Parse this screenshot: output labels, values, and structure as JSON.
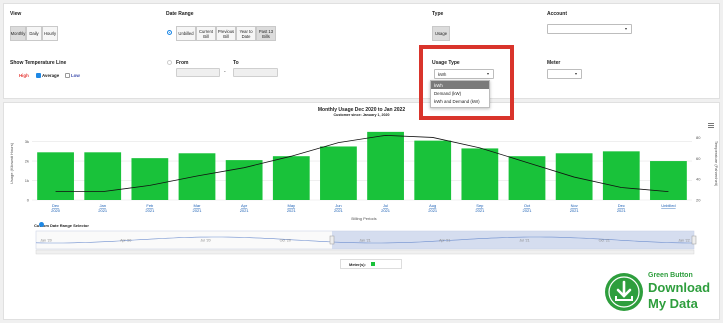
{
  "view": {
    "label": "View",
    "options": [
      "Monthly",
      "Daily",
      "Hourly"
    ],
    "selected": "Monthly"
  },
  "date_range": {
    "label": "Date Range",
    "options": [
      "Unbilled",
      "Current Bill",
      "Previous Bill",
      "Year to Date",
      "Past 13 Bills"
    ],
    "selected": "Past 13 Bills"
  },
  "type": {
    "label": "Type",
    "button": "Usage"
  },
  "account": {
    "label": "Account",
    "value": ""
  },
  "temperature": {
    "label": "Show Temperature Line",
    "high": "High",
    "average": "Average",
    "low": "Low",
    "colors": {
      "high": "#e53935",
      "average": "#1e88e5",
      "low": "#3949ab"
    }
  },
  "from": {
    "label": "From",
    "value": ""
  },
  "to": {
    "label": "To",
    "value": ""
  },
  "date_sep": "-",
  "usage_type": {
    "label": "Usage Type",
    "value": "kWh",
    "options": [
      "kWh",
      "Demand (kW)",
      "kWh and Demand (kW)"
    ]
  },
  "meter": {
    "label": "Meter",
    "value": ""
  },
  "chart": {
    "title": "Monthly Usage Dec 2020 to Jan 2022",
    "subtitle": "Customer since: January 1, 2020",
    "ylabel": "Usage (Kilowatt Hours)",
    "y2label": "Temperature (Fahrenheit)",
    "xlabel": "Billing Periods",
    "yticks": [
      "3k",
      "2k",
      "1k",
      "0"
    ],
    "y2ticks": [
      "80",
      "60",
      "40",
      "20"
    ],
    "bar_color": "#19c23a",
    "line_color": "#111111"
  },
  "chart_data": {
    "type": "bar",
    "categories": [
      [
        "Dec",
        "2020"
      ],
      [
        "Jan",
        "2021"
      ],
      [
        "Feb",
        "2021"
      ],
      [
        "Mar",
        "2021"
      ],
      [
        "Apr",
        "2021"
      ],
      [
        "May",
        "2021"
      ],
      [
        "Jun",
        "2021"
      ],
      [
        "Jul",
        "2021"
      ],
      [
        "Aug",
        "2021"
      ],
      [
        "Sep",
        "2021"
      ],
      [
        "Oct",
        "2021"
      ],
      [
        "Nov",
        "2021"
      ],
      [
        "Dec",
        "2021"
      ],
      [
        "Unbilled",
        ""
      ]
    ],
    "values": [
      2450,
      2450,
      2150,
      2400,
      2050,
      2250,
      2750,
      3500,
      3050,
      2650,
      2250,
      2400,
      2500,
      2000
    ],
    "temperature": [
      28,
      28,
      34,
      43,
      51,
      62,
      75,
      82,
      80,
      70,
      56,
      42,
      32,
      28
    ],
    "ylim": [
      0,
      3750
    ],
    "y2lim": [
      20,
      90
    ]
  },
  "range_selector": {
    "label": "Custom Date Range Selector",
    "ticks": [
      "Jan '20",
      "Apr '20",
      "Jul '20",
      "Oct '20",
      "Jan '21",
      "Apr '21",
      "Jul '21",
      "Oct '21",
      "Jan '22"
    ]
  },
  "legend": {
    "label": "Meter(s):",
    "color": "#19c23a"
  },
  "badge": {
    "line1": "Green Button",
    "line2": "Download",
    "line3": "My Data",
    "color": "#2e9e3d"
  }
}
